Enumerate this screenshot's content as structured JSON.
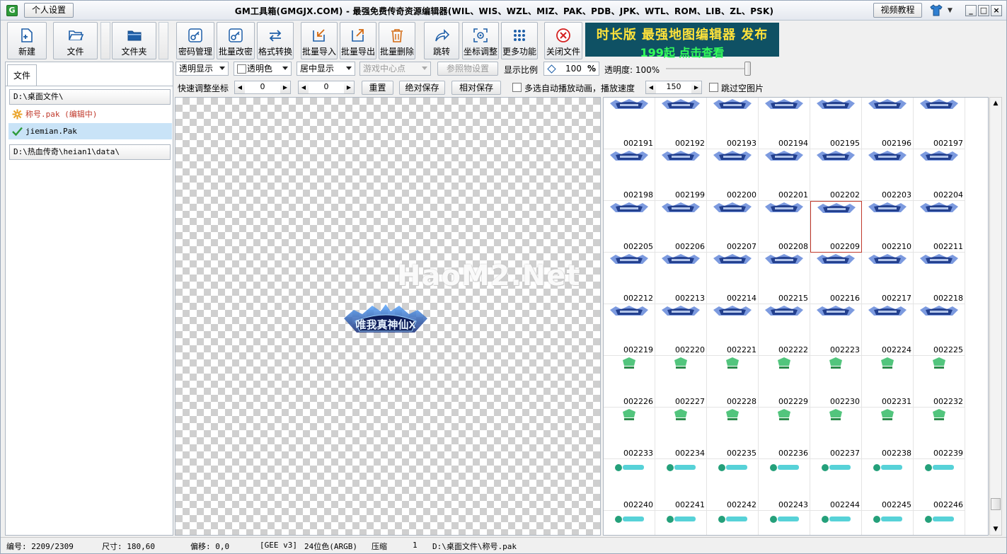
{
  "window": {
    "title": "GM工具箱(GMGJX.COM) - 最强免费传奇资源编辑器(WIL、WIS、WZL、MIZ、PAK、PDB、JPK、WTL、ROM、LIB、ZL、PSK)",
    "app_icon_letter": "G",
    "personal_settings": "个人设置",
    "video_tutorial": "视频教程"
  },
  "toolbar": {
    "new": "新建",
    "file": "文件",
    "folder": "文件夹",
    "password": "密码管理",
    "batch_password": "批量改密",
    "format_convert": "格式转换",
    "batch_import": "批量导入",
    "batch_export": "批量导出",
    "batch_delete": "批量删除",
    "jump": "跳转",
    "coord_adjust": "坐标调整",
    "more": "更多功能",
    "close_file": "关闭文件"
  },
  "banner": {
    "line1": "时长版 最强地图编辑器 发布",
    "line2": "199起 点击查看"
  },
  "left_panel": {
    "tab": "文件",
    "path1": "D:\\桌面文件\\",
    "files": [
      {
        "name": "称号.pak (编辑中)",
        "color": "#c0392b",
        "icon": "gear-icon"
      },
      {
        "name": "jiemian.Pak",
        "color": "#000000",
        "icon": "checkmark-icon"
      }
    ],
    "path2": "D:\\热血传奇\\heian1\\data\\"
  },
  "options": {
    "display_mode": "透明显示",
    "transparent_color": "透明色",
    "center_display": "居中显示",
    "game_center": "游戏中心点",
    "reference_settings": "参照物设置",
    "scale_label": "显示比例",
    "scale_value": "100",
    "scale_unit": "%",
    "opacity_label": "透明度: 100%",
    "opacity_value": 100,
    "quick_adjust": "快速调整坐标",
    "x_value": "0",
    "y_value": "0",
    "reset": "重置",
    "abs_save": "绝对保存",
    "rel_save": "相对保存",
    "autoplay_label": "多选自动播放动画，播放速度",
    "speed_value": "150",
    "skip_empty": "跳过空图片"
  },
  "preview": {
    "text": "唯我真神仙X"
  },
  "watermark": "HaoM2.Net",
  "grid": {
    "columns": 7,
    "selected": "002209",
    "rows": [
      {
        "type": "crown",
        "numbers": [
          "002191",
          "002192",
          "002193",
          "002194",
          "002195",
          "002196",
          "002197"
        ]
      },
      {
        "type": "crown",
        "numbers": [
          "002198",
          "002199",
          "002200",
          "002201",
          "002202",
          "002203",
          "002204"
        ]
      },
      {
        "type": "crown",
        "numbers": [
          "002205",
          "002206",
          "002207",
          "002208",
          "002209",
          "002210",
          "002211"
        ]
      },
      {
        "type": "crown",
        "numbers": [
          "002212",
          "002213",
          "002214",
          "002215",
          "002216",
          "002217",
          "002218"
        ]
      },
      {
        "type": "crown",
        "numbers": [
          "002219",
          "002220",
          "002221",
          "002222",
          "002223",
          "002224",
          "002225"
        ]
      },
      {
        "type": "green",
        "numbers": [
          "002226",
          "002227",
          "002228",
          "002229",
          "002230",
          "002231",
          "002232"
        ]
      },
      {
        "type": "green",
        "numbers": [
          "002233",
          "002234",
          "002235",
          "002236",
          "002237",
          "002238",
          "002239"
        ]
      },
      {
        "type": "badge",
        "numbers": [
          "002240",
          "002241",
          "002242",
          "002243",
          "002244",
          "002245",
          "002246"
        ]
      },
      {
        "type": "badge",
        "numbers": [
          "",
          "",
          "",
          "",
          "",
          "",
          ""
        ]
      }
    ]
  },
  "status": {
    "index": "编号: 2209/2309",
    "size": "尺寸: 180,60",
    "offset": "偏移: 0,0",
    "format": "[GEE v3]",
    "color_depth": "24位色(ARGB)",
    "compress": "压缩",
    "compress_value": "1",
    "path": "D:\\桌面文件\\称号.pak"
  },
  "colors": {
    "accent": "#1f5fa8",
    "banner_bg": "#0f5164",
    "selected_border": "#c0392b"
  }
}
